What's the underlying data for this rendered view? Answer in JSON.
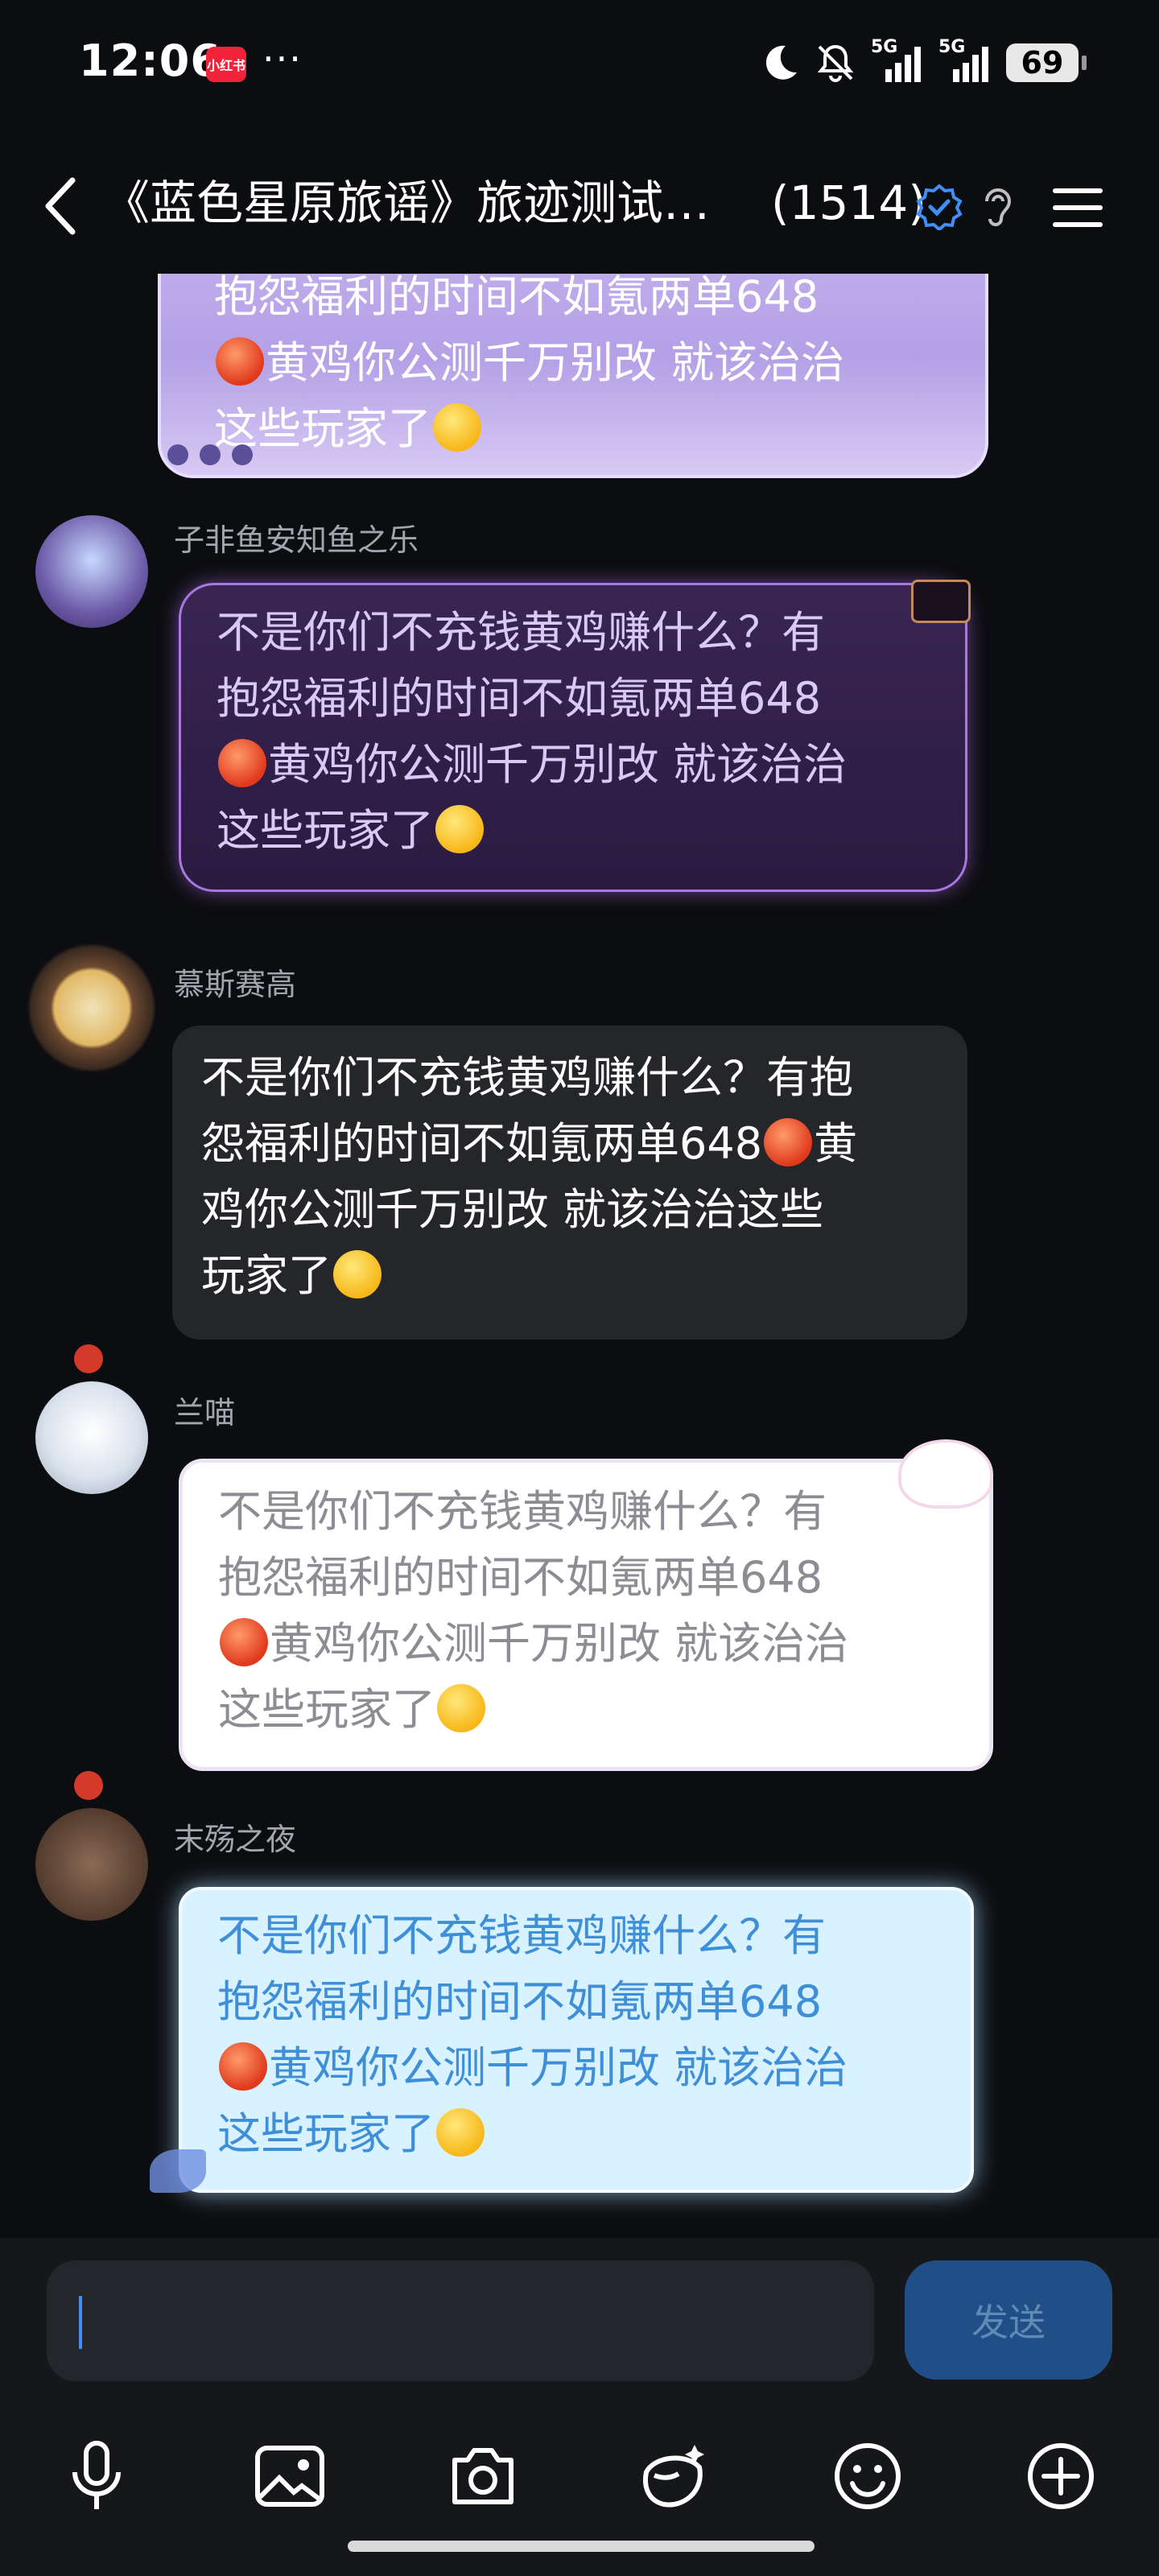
{
  "status_bar": {
    "time": "12:06",
    "app_badge": "小红书",
    "more": "···",
    "network1": "5G",
    "network2": "5G",
    "battery": "69"
  },
  "header": {
    "title": "《蓝色星原旅谣》旅迹测试…",
    "member_count": "(1514)"
  },
  "messages": [
    {
      "sender": "",
      "line1": "抱怨福利的时间不如氪两单648",
      "line2": "黄鸡你公测千万别改 就该治治",
      "line3": "这些玩家了"
    },
    {
      "sender": "子非鱼安知鱼之乐",
      "line1": "不是你们不充钱黄鸡赚什么？有",
      "line2": "抱怨福利的时间不如氪两单648",
      "line3": "黄鸡你公测千万别改 就该治治",
      "line4": "这些玩家了"
    },
    {
      "sender": "慕斯赛高",
      "line1": "不是你们不充钱黄鸡赚什么？有抱",
      "line2": "怨福利的时间不如氪两单648",
      "line2b": "黄",
      "line3": "鸡你公测千万别改 就该治治这些",
      "line4": "玩家了"
    },
    {
      "sender": "兰喵",
      "line1": "不是你们不充钱黄鸡赚什么？有",
      "line2": "抱怨福利的时间不如氪两单648",
      "line3": "黄鸡你公测千万别改 就该治治",
      "line4": "这些玩家了"
    },
    {
      "sender": "末殇之夜",
      "line1": "不是你们不充钱黄鸡赚什么？有",
      "line2": "抱怨福利的时间不如氪两单648",
      "line3": "黄鸡你公测千万别改 就该治治",
      "line4": "这些玩家了"
    }
  ],
  "input": {
    "placeholder": "",
    "send_label": "发送"
  },
  "toolbar": [
    "mic-icon",
    "image-icon",
    "camera-icon",
    "sticker-icon",
    "emoji-icon",
    "plus-icon"
  ]
}
